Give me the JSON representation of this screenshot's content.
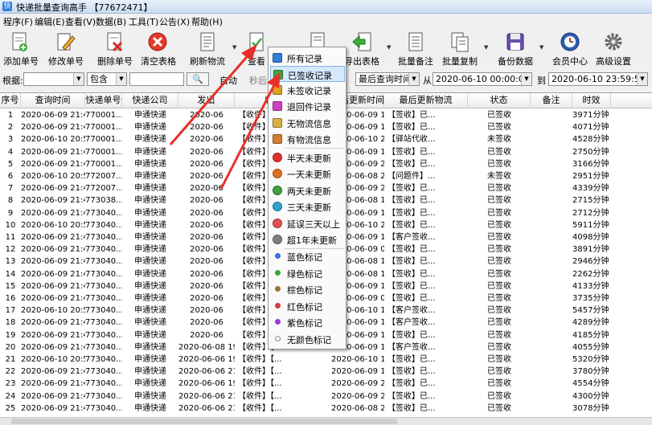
{
  "window": {
    "title": "快递批量查询高手 【77672471】"
  },
  "menu": [
    "程序(F)",
    "编辑(E)",
    "查看(V)",
    "数据(B)",
    "工具(T)",
    "公告(X)",
    "帮助(H)"
  ],
  "toolbar": [
    "添加单号",
    "修改单号",
    "删除单号",
    "清空表格",
    "刷新物流",
    "查看",
    "",
    "导出表格",
    "批量备注",
    "批量复制",
    "备份数据",
    "会员中心",
    "高级设置"
  ],
  "filter": {
    "label": "根据:",
    "combo1": "",
    "combo2": "包含",
    "btn_auto": "自动",
    "btn_refresh": "秒后",
    "combo_field": "最后查询时间",
    "from_label": "从",
    "from_value": "2020-06-10 00:00:00",
    "to_label": "到",
    "to_value": "2020-06-10 23:59:59"
  },
  "table": {
    "columns": [
      "序号",
      "查询时间",
      "快递单号",
      "快递公司",
      "发出",
      "物流信息",
      "最后更新时间",
      "最后更新物流",
      "状态",
      "备注",
      "时效"
    ],
    "rows": [
      [
        "1",
        "2020-06-09 21:40:29",
        "770001...",
        "申通快递",
        "2020-06",
        "【收件】【...",
        "2020-06-09 12:26:28",
        "【签收】已...",
        "已签收",
        "",
        "3971分钟"
      ],
      [
        "2",
        "2020-06-09 21:40:28",
        "770001...",
        "申通快递",
        "2020-06",
        "【收件】【...",
        "2020-06-09 15:56:04",
        "【签收】已...",
        "已签收",
        "",
        "4071分钟"
      ],
      [
        "3",
        "2020-06-10 20:57:31",
        "770001...",
        "申通快递",
        "2020-06",
        "【收件】【...",
        "2020-06-10 20:28:54",
        "【驿站代收...",
        "未签收",
        "",
        "4528分钟"
      ],
      [
        "4",
        "2020-06-09 21:40:26",
        "770001...",
        "申通快递",
        "2020-06",
        "【收件】【...",
        "2020-06-09 14:21:20",
        "【签收】已...",
        "已签收",
        "",
        "2750分钟"
      ],
      [
        "5",
        "2020-06-09 21:40:26",
        "770001...",
        "申通快递",
        "2020-06",
        "【收件】【...",
        "2020-06-09 21:17:19",
        "【签收】已...",
        "已签收",
        "",
        "3166分钟"
      ],
      [
        "6",
        "2020-06-10 20:57:30",
        "772007...",
        "申通快递",
        "2020-06",
        "【收件】【...",
        "2020-06-08 21:00:27",
        "【问题件】...",
        "未签收",
        "",
        "2951分钟"
      ],
      [
        "7",
        "2020-06-09 21:40:24",
        "772007...",
        "申通快递",
        "2020-06",
        "【收件】【快",
        "2020-06-09 20:31:48",
        "【签收】已...",
        "已签收",
        "",
        "4339分钟"
      ],
      [
        "8",
        "2020-06-09 21:40:23",
        "773038...",
        "申通快递",
        "2020-06",
        "【收件】【...",
        "2020-06-08 18:26:48",
        "【签收】已...",
        "已签收",
        "",
        "2715分钟"
      ],
      [
        "9",
        "2020-06-09 21:40:22",
        "773040...",
        "申通快递",
        "2020-06",
        "【收件】【快",
        "2020-06-09 18:00:31",
        "【签收】已...",
        "已签收",
        "",
        "2712分钟"
      ],
      [
        "10",
        "2020-06-10 20:57:29",
        "773040...",
        "申通快递",
        "2020-06",
        "【收件】【...",
        "2020-06-10 20:49:14",
        "【签收】已...",
        "已签收",
        "",
        "5911分钟"
      ],
      [
        "11",
        "2020-06-09 21:40:21",
        "773040...",
        "申通快递",
        "2020-06",
        "【收件】【...",
        "2020-06-09 14:53:03",
        "【客户签收...",
        "已签收",
        "",
        "4098分钟"
      ],
      [
        "12",
        "2020-06-09 21:40:20",
        "773040...",
        "申通快递",
        "2020-06",
        "【收件】【...",
        "2020-06-09 09:51:36",
        "【签收】已...",
        "已签收",
        "",
        "3891分钟"
      ],
      [
        "13",
        "2020-06-09 21:40:19",
        "773040...",
        "申通快递",
        "2020-06",
        "【收件】【...",
        "2020-06-08 19:40:47",
        "【签收】已...",
        "已签收",
        "",
        "2946分钟"
      ],
      [
        "14",
        "2020-06-09 21:40:17",
        "773040...",
        "申通快递",
        "2020-06",
        "【收件】【...",
        "2020-06-08 12:05:13",
        "【签收】已...",
        "已签收",
        "",
        "2262分钟"
      ],
      [
        "15",
        "2020-06-09 21:40:17",
        "773040...",
        "申通快递",
        "2020-06",
        "【收件】【...",
        "2020-06-09 15:15:42",
        "【签收】已...",
        "已签收",
        "",
        "4133分钟"
      ],
      [
        "16",
        "2020-06-09 21:40:16",
        "773040...",
        "申通快递",
        "2020-06",
        "【收件】【...",
        "2020-06-09 09:53:42",
        "【签收】已...",
        "已签收",
        "",
        "3735分钟"
      ],
      [
        "17",
        "2020-06-10 20:57:28",
        "773040...",
        "申通快递",
        "2020-06",
        "【收件】【...",
        "2020-06-10 17:33:12",
        "【客户签收...",
        "已签收",
        "",
        "5457分钟"
      ],
      [
        "18",
        "2020-06-09 21:40:14",
        "773040...",
        "申通快递",
        "2020-06",
        "【收件】【...",
        "2020-06-09 18:55:35",
        "【客户签收...",
        "已签收",
        "",
        "4289分钟"
      ],
      [
        "19",
        "2020-06-09 21:40:14",
        "773040...",
        "申通快递",
        "2020-06",
        "【收件】【...",
        "2020-06-09 16:19:56",
        "【签收】已...",
        "已签收",
        "",
        "4185分钟"
      ],
      [
        "20",
        "2020-06-09 21:40:13",
        "773040...",
        "申通快递",
        "2020-06-08 19:17:52",
        "【收件】【...",
        "2020-06-09 17:45:52",
        "【客户签收...",
        "已签收",
        "",
        "4055分钟"
      ],
      [
        "21",
        "2020-06-10 20:57:28",
        "773040...",
        "申通快递",
        "2020-06-06 19:10:34",
        "【收件】【...",
        "2020-06-10 13:50:23",
        "【签收】已...",
        "已签收",
        "",
        "5320分钟"
      ],
      [
        "22",
        "2020-06-09 21:40:10",
        "773040...",
        "申通快递",
        "2020-06-06 21:45:17",
        "【收件】【...",
        "2020-06-09 12:45:28",
        "【签收】已...",
        "已签收",
        "",
        "3780分钟"
      ],
      [
        "23",
        "2020-06-09 21:40:10",
        "773040...",
        "申通快递",
        "2020-06-06 19:19:27",
        "【收件】【...",
        "2020-06-09 21:13:54",
        "【签收】已...",
        "已签收",
        "",
        "4554分钟"
      ],
      [
        "24",
        "2020-06-09 21:40:08",
        "773040...",
        "申通快递",
        "2020-06-06 21:38:07",
        "【收件】【...",
        "2020-06-09 21:18:15",
        "【签收】已...",
        "已签收",
        "",
        "4300分钟"
      ],
      [
        "25",
        "2020-06-09 21:40:08",
        "773040...",
        "申通快递",
        "2020-06-06 21:23:03",
        "【收件】【...",
        "2020-06-08 20:51:25",
        "【签收】已...",
        "已签收",
        "",
        "3078分钟"
      ]
    ]
  },
  "context_menu": [
    {
      "label": "所有记录",
      "icon": "all-records-icon",
      "color": "#2f7fd8"
    },
    {
      "label": "已签收记录",
      "icon": "signed-records-icon",
      "color": "#3aa83a"
    },
    {
      "label": "未签收记录",
      "icon": "unsigned-records-icon",
      "color": "#e0a020"
    },
    {
      "label": "退回件记录",
      "icon": "returned-records-icon",
      "color": "#d040c0"
    },
    {
      "label": "无物流信息",
      "icon": "no-logistics-icon",
      "color": "#d8b040"
    },
    {
      "label": "有物流信息",
      "icon": "has-logistics-icon",
      "color": "#d08030"
    },
    {
      "label": "半天未更新",
      "icon": "half-day-icon",
      "color": "#e03030"
    },
    {
      "label": "一天未更新",
      "icon": "one-day-icon",
      "color": "#e07020"
    },
    {
      "label": "两天未更新",
      "icon": "two-days-icon",
      "color": "#40a040"
    },
    {
      "label": "三天未更新",
      "icon": "three-days-icon",
      "color": "#30a0d0"
    },
    {
      "label": "延误三天以上",
      "icon": "delayed-icon",
      "color": "#e05050"
    },
    {
      "label": "超1年未更新",
      "icon": "over-year-icon",
      "color": "#808080"
    },
    {
      "label": "蓝色标记",
      "icon": "blue-mark-icon",
      "color": "#3a6fd8"
    },
    {
      "label": "绿色标记",
      "icon": "green-mark-icon",
      "color": "#3aa83a"
    },
    {
      "label": "棕色标记",
      "icon": "brown-mark-icon",
      "color": "#a0703a"
    },
    {
      "label": "红色标记",
      "icon": "red-mark-icon",
      "color": "#d83a3a"
    },
    {
      "label": "紫色标记",
      "icon": "purple-mark-icon",
      "color": "#9a3ad8"
    },
    {
      "label": "无颜色标记",
      "icon": "no-color-mark-icon",
      "color": "#ffffff"
    }
  ],
  "colors": {
    "arrow": "#e8302a",
    "highlight": "#d6e8fb"
  }
}
